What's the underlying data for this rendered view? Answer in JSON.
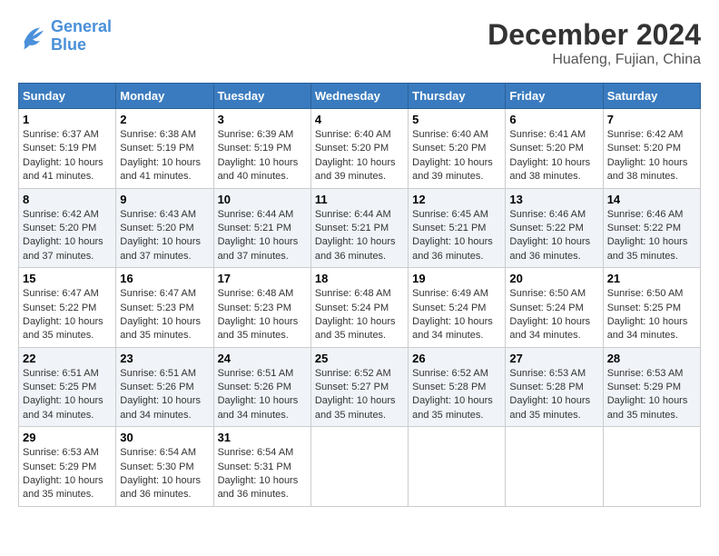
{
  "header": {
    "logo_line1": "General",
    "logo_line2": "Blue",
    "month": "December 2024",
    "location": "Huafeng, Fujian, China"
  },
  "weekdays": [
    "Sunday",
    "Monday",
    "Tuesday",
    "Wednesday",
    "Thursday",
    "Friday",
    "Saturday"
  ],
  "weeks": [
    [
      {
        "day": "1",
        "sunrise": "6:37 AM",
        "sunset": "5:19 PM",
        "daylight": "10 hours and 41 minutes."
      },
      {
        "day": "2",
        "sunrise": "6:38 AM",
        "sunset": "5:19 PM",
        "daylight": "10 hours and 41 minutes."
      },
      {
        "day": "3",
        "sunrise": "6:39 AM",
        "sunset": "5:19 PM",
        "daylight": "10 hours and 40 minutes."
      },
      {
        "day": "4",
        "sunrise": "6:40 AM",
        "sunset": "5:20 PM",
        "daylight": "10 hours and 39 minutes."
      },
      {
        "day": "5",
        "sunrise": "6:40 AM",
        "sunset": "5:20 PM",
        "daylight": "10 hours and 39 minutes."
      },
      {
        "day": "6",
        "sunrise": "6:41 AM",
        "sunset": "5:20 PM",
        "daylight": "10 hours and 38 minutes."
      },
      {
        "day": "7",
        "sunrise": "6:42 AM",
        "sunset": "5:20 PM",
        "daylight": "10 hours and 38 minutes."
      }
    ],
    [
      {
        "day": "8",
        "sunrise": "6:42 AM",
        "sunset": "5:20 PM",
        "daylight": "10 hours and 37 minutes."
      },
      {
        "day": "9",
        "sunrise": "6:43 AM",
        "sunset": "5:20 PM",
        "daylight": "10 hours and 37 minutes."
      },
      {
        "day": "10",
        "sunrise": "6:44 AM",
        "sunset": "5:21 PM",
        "daylight": "10 hours and 37 minutes."
      },
      {
        "day": "11",
        "sunrise": "6:44 AM",
        "sunset": "5:21 PM",
        "daylight": "10 hours and 36 minutes."
      },
      {
        "day": "12",
        "sunrise": "6:45 AM",
        "sunset": "5:21 PM",
        "daylight": "10 hours and 36 minutes."
      },
      {
        "day": "13",
        "sunrise": "6:46 AM",
        "sunset": "5:22 PM",
        "daylight": "10 hours and 36 minutes."
      },
      {
        "day": "14",
        "sunrise": "6:46 AM",
        "sunset": "5:22 PM",
        "daylight": "10 hours and 35 minutes."
      }
    ],
    [
      {
        "day": "15",
        "sunrise": "6:47 AM",
        "sunset": "5:22 PM",
        "daylight": "10 hours and 35 minutes."
      },
      {
        "day": "16",
        "sunrise": "6:47 AM",
        "sunset": "5:23 PM",
        "daylight": "10 hours and 35 minutes."
      },
      {
        "day": "17",
        "sunrise": "6:48 AM",
        "sunset": "5:23 PM",
        "daylight": "10 hours and 35 minutes."
      },
      {
        "day": "18",
        "sunrise": "6:48 AM",
        "sunset": "5:24 PM",
        "daylight": "10 hours and 35 minutes."
      },
      {
        "day": "19",
        "sunrise": "6:49 AM",
        "sunset": "5:24 PM",
        "daylight": "10 hours and 34 minutes."
      },
      {
        "day": "20",
        "sunrise": "6:50 AM",
        "sunset": "5:24 PM",
        "daylight": "10 hours and 34 minutes."
      },
      {
        "day": "21",
        "sunrise": "6:50 AM",
        "sunset": "5:25 PM",
        "daylight": "10 hours and 34 minutes."
      }
    ],
    [
      {
        "day": "22",
        "sunrise": "6:51 AM",
        "sunset": "5:25 PM",
        "daylight": "10 hours and 34 minutes."
      },
      {
        "day": "23",
        "sunrise": "6:51 AM",
        "sunset": "5:26 PM",
        "daylight": "10 hours and 34 minutes."
      },
      {
        "day": "24",
        "sunrise": "6:51 AM",
        "sunset": "5:26 PM",
        "daylight": "10 hours and 34 minutes."
      },
      {
        "day": "25",
        "sunrise": "6:52 AM",
        "sunset": "5:27 PM",
        "daylight": "10 hours and 35 minutes."
      },
      {
        "day": "26",
        "sunrise": "6:52 AM",
        "sunset": "5:28 PM",
        "daylight": "10 hours and 35 minutes."
      },
      {
        "day": "27",
        "sunrise": "6:53 AM",
        "sunset": "5:28 PM",
        "daylight": "10 hours and 35 minutes."
      },
      {
        "day": "28",
        "sunrise": "6:53 AM",
        "sunset": "5:29 PM",
        "daylight": "10 hours and 35 minutes."
      }
    ],
    [
      {
        "day": "29",
        "sunrise": "6:53 AM",
        "sunset": "5:29 PM",
        "daylight": "10 hours and 35 minutes."
      },
      {
        "day": "30",
        "sunrise": "6:54 AM",
        "sunset": "5:30 PM",
        "daylight": "10 hours and 36 minutes."
      },
      {
        "day": "31",
        "sunrise": "6:54 AM",
        "sunset": "5:31 PM",
        "daylight": "10 hours and 36 minutes."
      },
      null,
      null,
      null,
      null
    ]
  ],
  "labels": {
    "sunrise": "Sunrise:",
    "sunset": "Sunset:",
    "daylight": "Daylight:"
  }
}
